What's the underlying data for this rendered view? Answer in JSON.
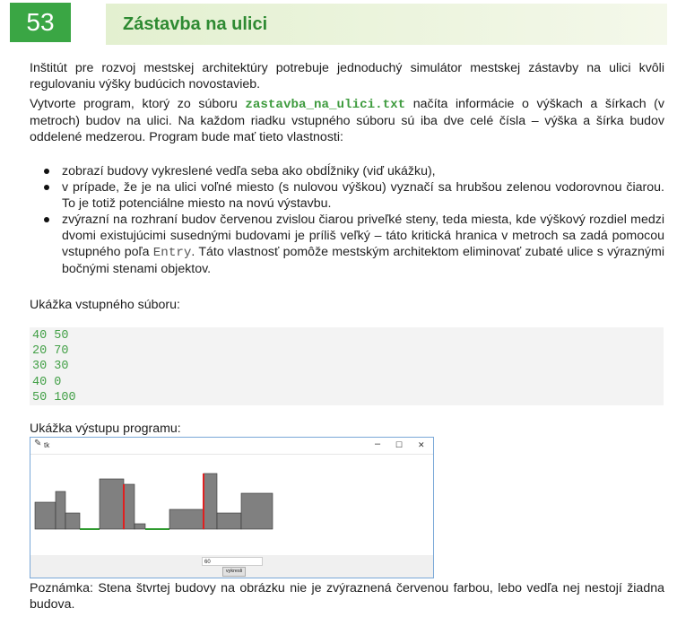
{
  "header": {
    "number": "53",
    "title": "Zástavba na ulici"
  },
  "intro": {
    "p1": "Inštitút pre rozvoj mestskej architektúry potrebuje jednoduchý simulátor mestskej zástavby na ulici kvôli regulovaniu výšky budúcich novostavieb.",
    "p2_a": "Vytvorte program, ktorý zo súboru ",
    "p2_file": "zastavba_na_ulici.txt",
    "p2_b": " načíta informácie o výškach a šírkach (v metroch) budov na ulici. Na každom riadku vstupného súboru sú iba dve celé čísla – výška a šírka budov oddelené medzerou. Program bude mať tieto vlastnosti:"
  },
  "bullets": {
    "b1": "zobrazí budovy vykreslené vedľa seba ako obdĺžniky (viď ukážku),",
    "b2": "v prípade, že je na ulici voľné miesto (s nulovou výškou) vyznačí sa hrubšou zelenou vodorovnou čiarou. To je totiž potenciálne miesto na novú výstavbu.",
    "b3_a": "zvýrazní na rozhraní budov červenou zvislou čiarou priveľké steny, teda miesta, kde výškový rozdiel medzi dvomi existujúcimi susednými budovami je príliš veľký – táto kritická hranica v metroch sa zadá pomocou vstupného poľa ",
    "b3_code": "Entry",
    "b3_b": ". Táto vlastnosť pomôže mestským architektom eliminovať zubaté ulice s výraznými bočnými stenami objektov."
  },
  "input_example": {
    "label": "Ukážka vstupného súboru:",
    "lines": [
      "40 50",
      "20 70",
      "30 30",
      "40 0",
      "50 100"
    ]
  },
  "output_example": {
    "label": "Ukážka výstupu programu:",
    "window_title": "tk",
    "ctrl_min": "–",
    "ctrl_max": "☐",
    "ctrl_close": "✕",
    "entry_value": "60",
    "button_label": "vykresli",
    "colors": {
      "building": "#808080",
      "wall": "#e02020",
      "empty": "#2e9a2e"
    }
  },
  "note": "Poznámka: Stena štvrtej budovy na obrázku nie je zvýraznená červenou farbou, lebo vedľa nej nestojí žiadna budova."
}
